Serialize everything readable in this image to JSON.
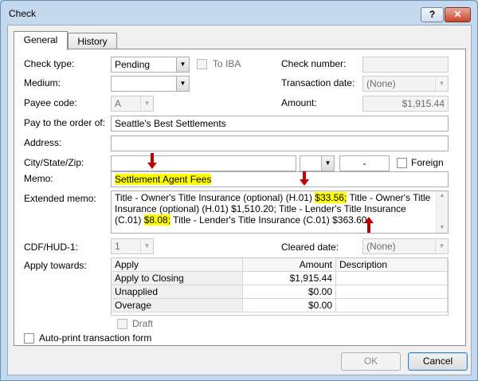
{
  "window": {
    "title": "Check",
    "help_label": "?",
    "close_label": "✕"
  },
  "tabs": [
    {
      "label": "General"
    },
    {
      "label": "History"
    }
  ],
  "form": {
    "check_type": {
      "label": "Check type:",
      "value": "Pending"
    },
    "to_iba": {
      "label": "To IBA",
      "checked": false
    },
    "check_number": {
      "label": "Check number:",
      "value": ""
    },
    "medium": {
      "label": "Medium:",
      "value": ""
    },
    "transaction_date": {
      "label": "Transaction date:",
      "value": "(None)"
    },
    "payee_code": {
      "label": "Payee code:",
      "value": "A"
    },
    "amount": {
      "label": "Amount:",
      "value": "$1,915.44"
    },
    "pay_to": {
      "label": "Pay to the order of:",
      "value": "Seattle's Best Settlements"
    },
    "address": {
      "label": "Address:",
      "value": ""
    },
    "city_state_zip": {
      "label": "City/State/Zip:",
      "city": "",
      "state": "",
      "zip": "-"
    },
    "foreign": {
      "label": "Foreign",
      "checked": false
    },
    "memo": {
      "label": "Memo:",
      "value": "Settlement Agent Fees"
    },
    "extended_memo": {
      "label": "Extended memo:",
      "part1": "Title - Owner's Title Insurance (optional) (H.01) ",
      "hl1": "$33.56;",
      "part2": " Title - Owner's Title Insurance (optional) (H.01) $1,510.20; Title - Lender's Title Insurance (C.01) ",
      "hl2": "$8.08;",
      "part3": " Title - Lender's Title Insurance (C.01) $363.60"
    },
    "cdf_hud": {
      "label": "CDF/HUD-1:",
      "value": "1"
    },
    "cleared_date": {
      "label": "Cleared date:",
      "value": "(None)"
    },
    "apply_towards": {
      "label": "Apply towards:"
    },
    "draft": {
      "label": "Draft",
      "checked": false
    },
    "auto_print": {
      "label": "Auto-print transaction form",
      "checked": false
    }
  },
  "apply_grid": {
    "headers": {
      "apply": "Apply",
      "amount": "Amount",
      "description": "Description"
    },
    "rows": [
      {
        "apply": "Apply to Closing",
        "amount": "$1,915.44",
        "description": ""
      },
      {
        "apply": "Unapplied",
        "amount": "$0.00",
        "description": ""
      },
      {
        "apply": "Overage",
        "amount": "$0.00",
        "description": ""
      }
    ]
  },
  "buttons": {
    "ok": "OK",
    "cancel": "Cancel"
  },
  "colors": {
    "highlight": "#ffff00",
    "annotation_arrow": "#c00000",
    "window_frame": "#c5d9ee"
  }
}
